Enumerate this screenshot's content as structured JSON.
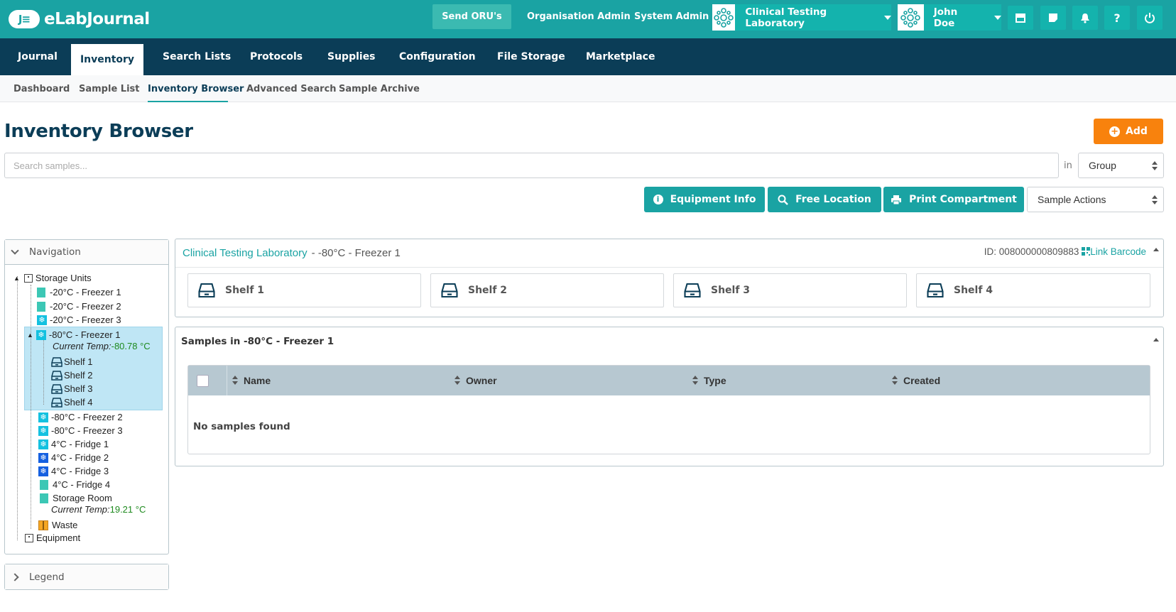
{
  "brand": {
    "badge": "J≡",
    "name": "eLabJournal"
  },
  "topbar": {
    "send_btn": "Send ORU's",
    "org_admin": "Organisation Admin",
    "sys_admin": "System Admin",
    "lab_name": "Clinical Testing Laboratory",
    "user_name": "John Doe",
    "icons": [
      "store-icon",
      "note-icon",
      "bell-icon",
      "help-icon",
      "power-icon"
    ]
  },
  "mainnav": [
    "Journal",
    "Inventory",
    "Search Lists",
    "Protocols",
    "Supplies",
    "Configuration",
    "File Storage",
    "Marketplace"
  ],
  "subnav": [
    "Dashboard",
    "Sample List",
    "Inventory Browser",
    "Advanced Search",
    "Sample Archive"
  ],
  "page": {
    "title": "Inventory Browser",
    "add_label": "Add",
    "search_placeholder": "Search samples...",
    "in_label": "in",
    "scope_value": "Group",
    "equipment_info": "Equipment Info",
    "free_location": "Free Location",
    "print_compartment": "Print Compartment",
    "sample_actions": "Sample Actions"
  },
  "navigation": {
    "title": "Navigation",
    "legend": "Legend",
    "root": "Storage Units",
    "items": [
      "-20°C - Freezer 1",
      "-20°C - Freezer 2",
      "-20°C - Freezer 3",
      "-80°C - Freezer 1",
      "-80°C - Freezer 2",
      "-80°C - Freezer 3",
      "4°C - Fridge 1",
      "4°C - Fridge 2",
      "4°C - Fridge 3",
      "4°C - Fridge 4",
      "Storage Room",
      "Waste"
    ],
    "selected_temp_label": "Current Temp: ",
    "selected_temp_value": "-80.78 °C",
    "room_temp_label": "Current Temp: ",
    "room_temp_value": "19.21 °C",
    "shelves": [
      "Shelf 1",
      "Shelf 2",
      "Shelf 3",
      "Shelf 4"
    ],
    "equipment": "Equipment"
  },
  "freezer": {
    "lab": "Clinical Testing Laboratory",
    "name": "- -80°C - Freezer 1",
    "id_label": "ID: 008000000809883",
    "link_barcode": "Link Barcode",
    "shelves": [
      "Shelf 1",
      "Shelf 2",
      "Shelf 3",
      "Shelf 4"
    ]
  },
  "samples": {
    "title": "Samples in -80°C - Freezer 1",
    "columns": [
      "Name",
      "Owner",
      "Type",
      "Created"
    ],
    "empty": "No samples found"
  },
  "colors": {
    "teal": "#1aa3a3",
    "navy": "#0b3d57",
    "orange": "#f8820d",
    "highlight": "#bfe6f5"
  }
}
